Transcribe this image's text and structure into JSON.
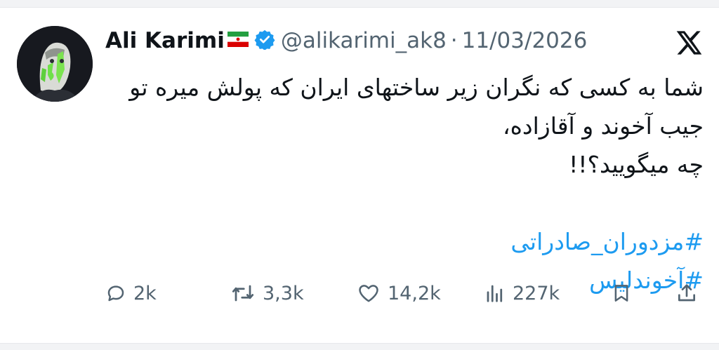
{
  "tweet": {
    "author_name": "Ali Karimi",
    "handle": "@alikarimi_ak8",
    "separator": "·",
    "date": "11/03/2026",
    "lines": [
      "شما به کسی که  نگران زیر ساختهای ایران که پولش میره تو",
      "جیب  آخوند و آقازاده،",
      "چه میگویید؟!!"
    ],
    "hashtags": [
      "#مزدوران_صادراتی",
      "#آخوندلیس"
    ]
  },
  "actions": {
    "replies": "2k",
    "reposts": "3,3k",
    "likes": "14,2k",
    "views": "227k"
  },
  "icons": {
    "verified": "verified-badge-icon",
    "flag": "iran-flag-icon",
    "brand": "x-logo-icon"
  },
  "colors": {
    "text": "#0f1419",
    "secondary": "#536471",
    "hashtag": "#1d9bf0",
    "verified": "#1d9bf0"
  }
}
